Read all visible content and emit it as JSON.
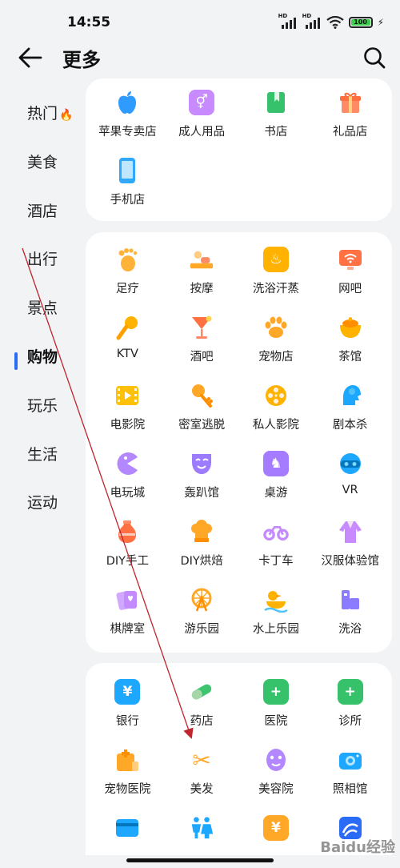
{
  "status": {
    "time": "14:55",
    "battery": "100",
    "signal_label": "HD"
  },
  "header": {
    "title": "更多",
    "back_icon": "arrow-left-icon",
    "search_icon": "search-icon"
  },
  "sidebar": {
    "items": [
      {
        "label": "热门",
        "active": false,
        "badge": "fire-icon"
      },
      {
        "label": "美食",
        "active": false
      },
      {
        "label": "酒店",
        "active": false
      },
      {
        "label": "出行",
        "active": false
      },
      {
        "label": "景点",
        "active": false
      },
      {
        "label": "购物",
        "active": true
      },
      {
        "label": "玩乐",
        "active": false
      },
      {
        "label": "生活",
        "active": false
      },
      {
        "label": "运动",
        "active": false
      }
    ]
  },
  "sections": [
    {
      "items": [
        {
          "label": "苹果专卖店",
          "icon": "apple-icon",
          "color": "#2f9bff",
          "glyph": ""
        },
        {
          "label": "成人用品",
          "icon": "gender-icon",
          "color": "#c88bff",
          "glyph": "⚥"
        },
        {
          "label": "书店",
          "icon": "book-icon",
          "color": "#35c26a",
          "glyph": ""
        },
        {
          "label": "礼品店",
          "icon": "gift-icon",
          "color": "#ff8a65",
          "glyph": ""
        },
        {
          "label": "手机店",
          "icon": "phone-icon",
          "color": "#2fa8ff",
          "glyph": ""
        }
      ]
    },
    {
      "items": [
        {
          "label": "足疗",
          "icon": "foot-icon",
          "color": "#ffb238",
          "glyph": ""
        },
        {
          "label": "按摩",
          "icon": "massage-icon",
          "color": "#ffa726",
          "glyph": ""
        },
        {
          "label": "洗浴汗蒸",
          "icon": "hot-spring-icon",
          "color": "#ffb300",
          "glyph": "♨"
        },
        {
          "label": "网吧",
          "icon": "wifi-monitor-icon",
          "color": "#ff7043",
          "glyph": ""
        },
        {
          "label": "KTV",
          "icon": "microphone-icon",
          "color": "#ffb300",
          "glyph": ""
        },
        {
          "label": "酒吧",
          "icon": "cocktail-icon",
          "color": "#ff7043",
          "glyph": ""
        },
        {
          "label": "宠物店",
          "icon": "paw-icon",
          "color": "#ffa726",
          "glyph": ""
        },
        {
          "label": "茶馆",
          "icon": "tea-icon",
          "color": "#ffb300",
          "glyph": ""
        },
        {
          "label": "电影院",
          "icon": "film-icon",
          "color": "#ffc107",
          "glyph": ""
        },
        {
          "label": "密室逃脱",
          "icon": "key-icon",
          "color": "#ffa726",
          "glyph": ""
        },
        {
          "label": "私人影院",
          "icon": "film-reel-icon",
          "color": "#ffb300",
          "glyph": ""
        },
        {
          "label": "剧本杀",
          "icon": "head-icon",
          "color": "#1ea7ff",
          "glyph": ""
        },
        {
          "label": "电玩城",
          "icon": "pacman-icon",
          "color": "#b388ff",
          "glyph": ""
        },
        {
          "label": "轰趴馆",
          "icon": "mask-icon",
          "color": "#9c7bff",
          "glyph": ""
        },
        {
          "label": "桌游",
          "icon": "chess-knight-icon",
          "color": "#a57bff",
          "glyph": "♞"
        },
        {
          "label": "VR",
          "icon": "vr-icon",
          "color": "#1ea7ff",
          "glyph": ""
        },
        {
          "label": "DIY手工",
          "icon": "vase-icon",
          "color": "#ff7043",
          "glyph": ""
        },
        {
          "label": "DIY烘焙",
          "icon": "chef-hat-icon",
          "color": "#ffa726",
          "glyph": ""
        },
        {
          "label": "卡丁车",
          "icon": "kart-icon",
          "color": "#c48bff",
          "glyph": ""
        },
        {
          "label": "汉服体验馆",
          "icon": "hanfu-icon",
          "color": "#c88bff",
          "glyph": ""
        },
        {
          "label": "棋牌室",
          "icon": "cards-icon",
          "color": "#c48bff",
          "glyph": ""
        },
        {
          "label": "游乐园",
          "icon": "ferris-wheel-icon",
          "color": "#ffa726",
          "glyph": ""
        },
        {
          "label": "水上乐园",
          "icon": "duck-icon",
          "color": "#ffb300",
          "glyph": ""
        },
        {
          "label": "洗浴",
          "icon": "bath-icon",
          "color": "#8b7bff",
          "glyph": ""
        }
      ]
    },
    {
      "items": [
        {
          "label": "银行",
          "icon": "bank-icon",
          "color": "#1ea7ff",
          "glyph": "¥"
        },
        {
          "label": "药店",
          "icon": "pill-icon",
          "color": "#3cc56d",
          "glyph": ""
        },
        {
          "label": "医院",
          "icon": "hospital-icon",
          "color": "#35c26a",
          "glyph": "+"
        },
        {
          "label": "诊所",
          "icon": "medical-kit-icon",
          "color": "#35c26a",
          "glyph": "+"
        },
        {
          "label": "宠物医院",
          "icon": "pet-hospital-icon",
          "color": "#ffa726",
          "glyph": ""
        },
        {
          "label": "美发",
          "icon": "scissors-icon",
          "color": "#ffffff",
          "glyph": "✂"
        },
        {
          "label": "美容院",
          "icon": "face-mask-icon",
          "color": "#b388ff",
          "glyph": ""
        },
        {
          "label": "照相馆",
          "icon": "camera-icon",
          "color": "#1ea7ff",
          "glyph": ""
        },
        {
          "label": "",
          "icon": "card-icon",
          "color": "#1ea7ff",
          "glyph": ""
        },
        {
          "label": "",
          "icon": "restroom-icon",
          "color": "#ffffff",
          "glyph": ""
        },
        {
          "label": "",
          "icon": "yuan-icon",
          "color": "#ffa726",
          "glyph": "¥"
        },
        {
          "label": "",
          "icon": "logo-icon",
          "color": "#2b6cf6",
          "glyph": ""
        }
      ]
    }
  ],
  "watermark": "Baidu经验"
}
